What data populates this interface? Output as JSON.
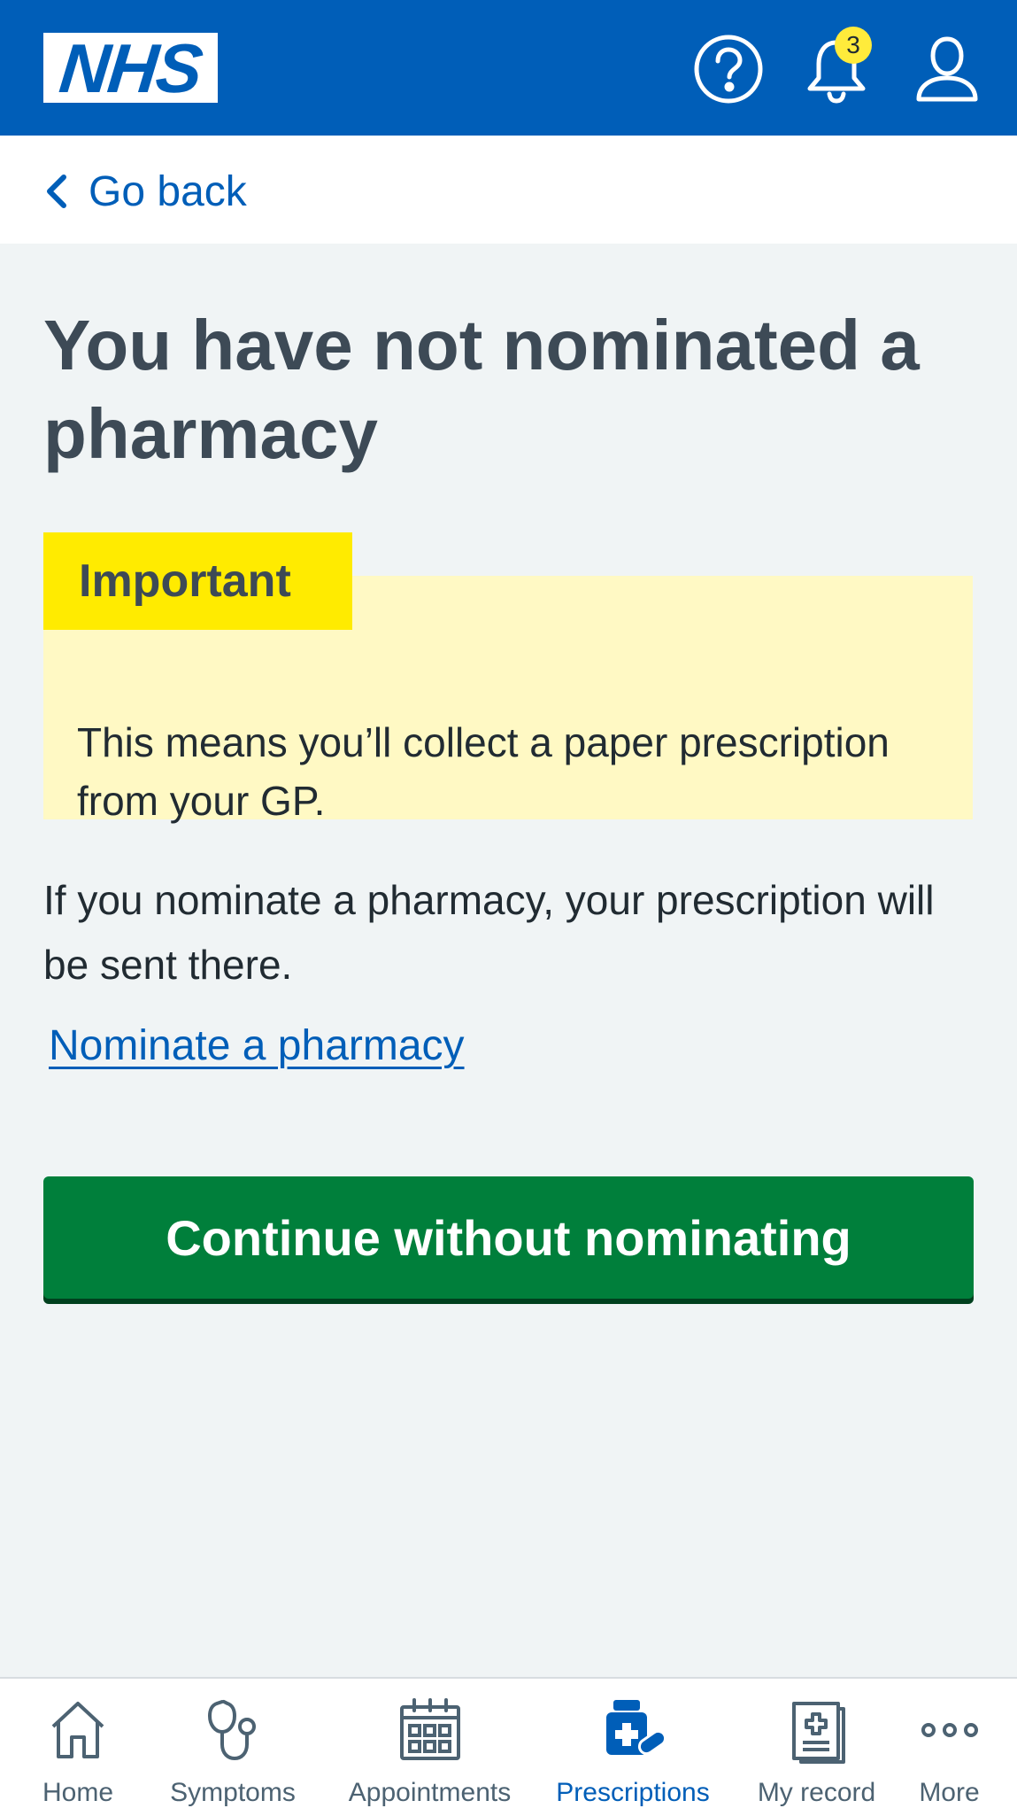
{
  "header": {
    "logo_text": "NHS",
    "help_icon": "help-circle-icon",
    "notifications_icon": "bell-icon",
    "notifications_count": "3",
    "account_icon": "account-icon",
    "brand_color": "#005eb8"
  },
  "nav": {
    "back_label": "Go back"
  },
  "main": {
    "title": "You have not nominated a pharmacy",
    "callout": {
      "label": "Important",
      "text": "This means you’ll collect a paper prescription from your GP."
    },
    "body_text": "If you nominate a pharmacy, your prescription will be sent there.",
    "nominate_link": "Nominate a pharmacy",
    "continue_button": "Continue without nominating"
  },
  "colors": {
    "button_green": "#007f3b",
    "callout_yellow": "#ffeb00",
    "callout_background": "#fff9c4",
    "link_blue": "#005eb8"
  },
  "bottom_nav": {
    "active": "Prescriptions",
    "items": [
      {
        "label": "Home",
        "icon": "home-icon"
      },
      {
        "label": "Symptoms",
        "icon": "stethoscope-icon"
      },
      {
        "label": "Appointments",
        "icon": "calendar-icon"
      },
      {
        "label": "Prescriptions",
        "icon": "medicine-icon"
      },
      {
        "label": "My record",
        "icon": "record-icon"
      },
      {
        "label": "More",
        "icon": "more-icon"
      }
    ]
  }
}
